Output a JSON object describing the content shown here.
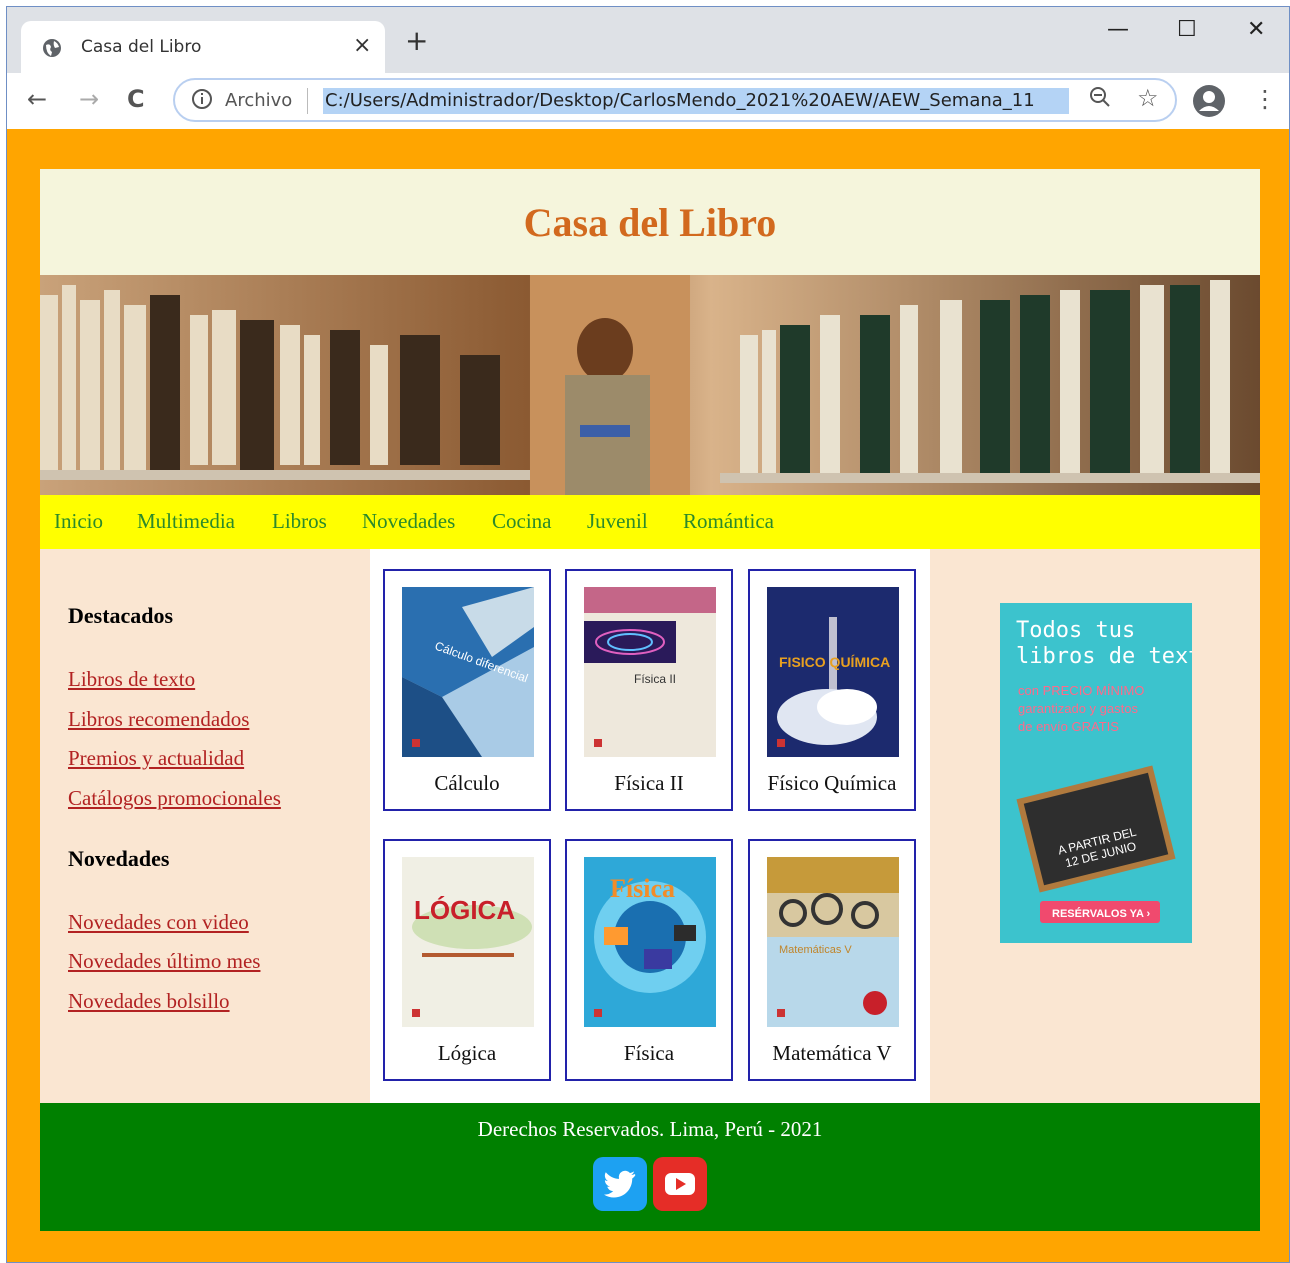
{
  "browser": {
    "tab_title": "Casa del Libro",
    "tab_close": "×",
    "new_tab": "+",
    "window_controls": {
      "minimize": "—",
      "maximize": "☐",
      "close": "✕"
    },
    "nav": {
      "back": "←",
      "forward": "→",
      "reload": "C"
    },
    "address": {
      "scheme_label": "Archivo",
      "url": "C:/Users/Administrador/Desktop/CarlosMendo_2021%20AEW/AEW_Semana_11"
    },
    "icons": {
      "zoom": "search-minus-icon",
      "bookmark": "star-icon",
      "profile": "account-icon",
      "menu": "kebab-icon"
    }
  },
  "site": {
    "title": "Casa del Libro",
    "menu": [
      "Inicio",
      "Multimedia",
      "Libros",
      "Novedades",
      "Cocina",
      "Juvenil",
      "Romántica"
    ],
    "sidebar": {
      "destacados_title": "Destacados",
      "destacados": [
        "Libros de texto",
        "Libros recomendados",
        "Premios y actualidad",
        "Catálogos promocionales"
      ],
      "novedades_title": "Novedades",
      "novedades": [
        "Novedades con video",
        "Novedades último mes",
        "Novedades bolsillo"
      ]
    },
    "books": [
      {
        "caption": "Cálculo",
        "cover_text": "Cálculo diferencial"
      },
      {
        "caption": "Física II",
        "cover_text": "Física II"
      },
      {
        "caption": "Físico Química",
        "cover_text": "FISICO QUÍMICA"
      },
      {
        "caption": "Lógica",
        "cover_text": "LÓGICA"
      },
      {
        "caption": "Física",
        "cover_text": "Física"
      },
      {
        "caption": "Matemática V",
        "cover_text": "Matemáticas V"
      }
    ],
    "ad": {
      "headline": "Todos tus libros de texto",
      "sub": "con PRECIO MÍNIMO garantizado y gastos de envío GRATIS",
      "board": "A PARTIR DEL 12 DE JUNIO",
      "cta": "RESÉRVALOS YA ›"
    },
    "footer": {
      "copyright": "Derechos Reservados. Lima, Perú - 2021",
      "social": [
        "twitter-icon",
        "youtube-icon"
      ]
    },
    "colors": {
      "page_bg": "#ffa500",
      "header_bg": "#f5f5dc",
      "title": "#d2691e",
      "menu_bg": "#ffff00",
      "menu_link": "#2b8a2b",
      "content_bg": "#fae6d2",
      "link": "#b22222",
      "footer_bg": "#008000"
    }
  }
}
